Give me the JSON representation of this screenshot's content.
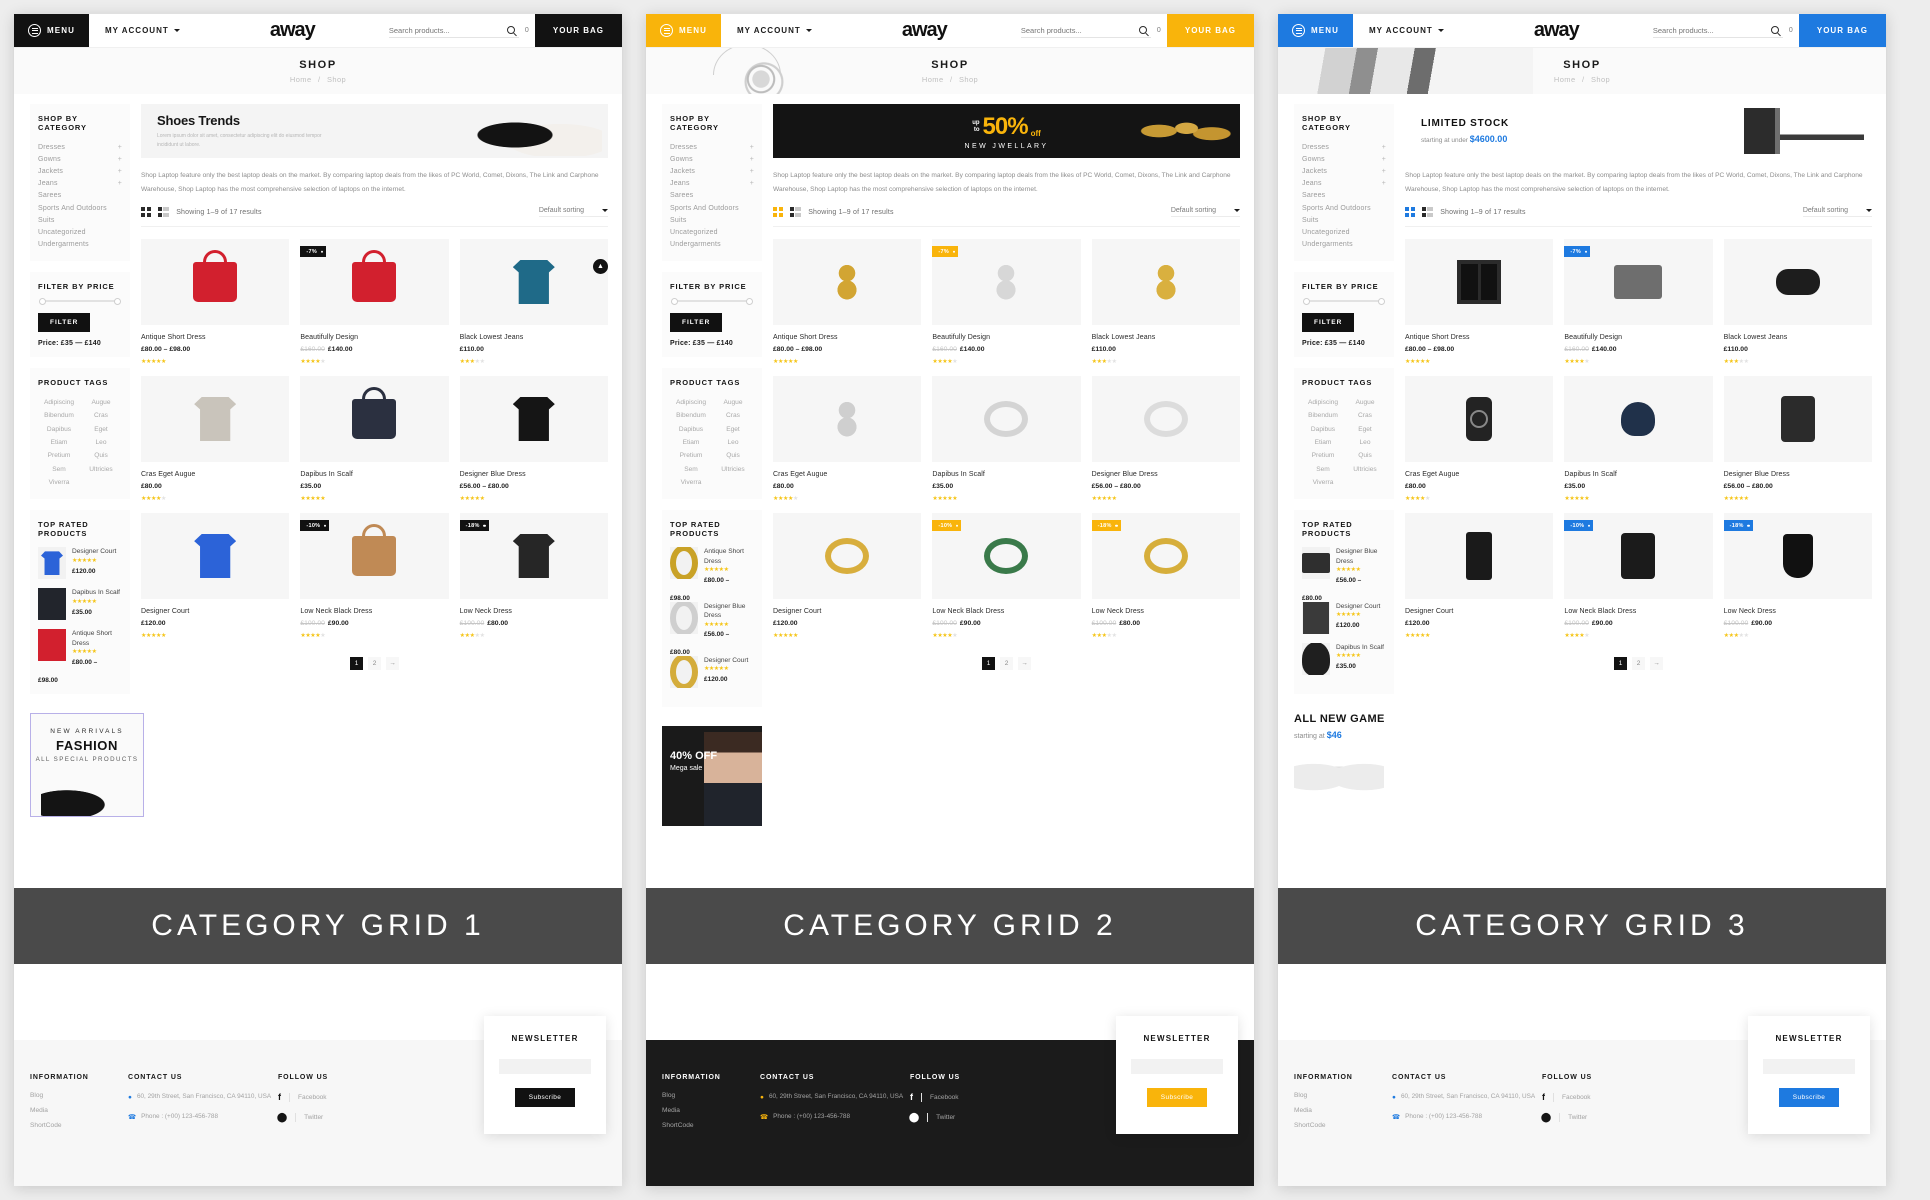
{
  "panels": [
    {
      "id": "grid1",
      "accent": "#121212",
      "caption": "CATEGORY GRID 1",
      "header": {
        "menu_label": "MENU",
        "account_label": "MY ACCOUNT",
        "logo": "away",
        "search_placeholder": "Search products...",
        "bag_count": "0",
        "bag_label": "YOUR BAG"
      },
      "page": {
        "title": "SHOP",
        "crumb_home": "Home",
        "crumb_sep": "/",
        "crumb_current": "Shop"
      },
      "promo": {
        "kind": "shoes",
        "title": "Shoes Trends",
        "subtitle": "Lorem ipsum dolor sit amet, consectetur adipiscing elit do eiusmod tempor incididunt ut labore."
      },
      "intro": "Shop Laptop feature only the best laptop deals on the market. By comparing laptop deals from the likes of PC World, Comet, Dixons, The Link and Carphone Warehouse, Shop Laptop has the most comprehensive selection of laptops on the internet.",
      "toolbar": {
        "showing": "Showing 1–9 of 17 results",
        "sort": "Default sorting"
      },
      "sidebar": {
        "category_title": "SHOP BY CATEGORY",
        "categories": [
          {
            "label": "Dresses",
            "expandable": true
          },
          {
            "label": "Gowns",
            "expandable": true
          },
          {
            "label": "Jackets",
            "expandable": true
          },
          {
            "label": "Jeans",
            "expandable": true
          },
          {
            "label": "Sarees",
            "expandable": false
          },
          {
            "label": "Sports And Outdoors",
            "expandable": false
          },
          {
            "label": "Suits",
            "expandable": false
          },
          {
            "label": "Uncategorized",
            "expandable": false
          },
          {
            "label": "Undergarments",
            "expandable": false
          }
        ],
        "filter_title": "FILTER BY PRICE",
        "filter_button": "FILTER",
        "price_range": "Price: £35 — £140",
        "tags_title": "PRODUCT TAGS",
        "tags": [
          "Adipiscing",
          "Augue",
          "Bibendum",
          "Cras",
          "Dapibus",
          "Eget",
          "Etiam",
          "Leo",
          "Pretium",
          "Quis",
          "Sem",
          "Ultricies",
          "Viverra"
        ],
        "top_rated_title": "TOP RATED PRODUCTS",
        "top_rated": [
          {
            "name": "Designer Court",
            "stars": 5,
            "price": "£120.00",
            "color": "#2c63d8",
            "shape": "shirt"
          },
          {
            "name": "Dapibus In Scalf",
            "stars": 5,
            "price": "£35.00",
            "color": "#22252c",
            "shape": "bag"
          },
          {
            "name": "Antique Short Dress",
            "stars": 5,
            "price_left": "£98.00",
            "price": "£80.00 –",
            "color": "#d2202e",
            "shape": "bag"
          }
        ]
      },
      "products": [
        {
          "name": "Antique Short Dress",
          "price": "£80.00 – £98.00",
          "old": "",
          "stars": 5,
          "badge": "",
          "color": "#d2202e",
          "shape": "bag"
        },
        {
          "name": "Beautifully Design",
          "price": "£140.00",
          "old": "£160.00",
          "stars": 4,
          "badge": "-7%",
          "color": "#d2202e",
          "shape": "bag"
        },
        {
          "name": "Black Lowest Jeans",
          "price": "£110.00",
          "old": "",
          "stars": 3,
          "badge": "",
          "color": "#1f6a88",
          "shape": "polo"
        },
        {
          "name": "Cras Eget Augue",
          "price": "£80.00",
          "old": "",
          "stars": 4,
          "badge": "",
          "color": "#c9c4bb",
          "shape": "sweater"
        },
        {
          "name": "Dapibus In Scalf",
          "price": "£35.00",
          "old": "",
          "stars": 5,
          "badge": "",
          "color": "#2b3040",
          "shape": "bag"
        },
        {
          "name": "Designer Blue Dress",
          "price": "£56.00 – £80.00",
          "old": "",
          "stars": 5,
          "badge": "",
          "color": "#151515",
          "shape": "tshirt"
        },
        {
          "name": "Designer Court",
          "price": "£120.00",
          "old": "",
          "stars": 5,
          "badge": "",
          "color": "#2c63d8",
          "shape": "polo"
        },
        {
          "name": "Low Neck Black Dress",
          "price": "£90.00",
          "old": "£100.00",
          "stars": 4,
          "badge": "-10%",
          "color": "#c08a55",
          "shape": "bag"
        },
        {
          "name": "Low Neck Dress",
          "price": "£80.00",
          "old": "£100.00",
          "stars": 3,
          "badge": "-18%",
          "color": "#262626",
          "shape": "tshirt"
        }
      ],
      "pager": {
        "pages": [
          "1",
          "2"
        ],
        "next": "→",
        "active": "1"
      },
      "lower_promo": {
        "kind": "fashion",
        "line1": "NEW ARRIVALS",
        "line2": "FASHION",
        "line3": "ALL SPECIAL PRODUCTS"
      },
      "footer": {
        "theme": "light",
        "information_title": "INFORMATION",
        "information_links": [
          "Blog",
          "Media",
          "ShortCode"
        ],
        "contact_title": "CONTACT US",
        "address": "60, 29th Street, San Francisco, CA 94110, USA",
        "phone": "Phone : (+00) 123-456-788",
        "follow_title": "FOLLOW US",
        "socials": [
          "Facebook",
          "Twitter"
        ],
        "newsletter_title": "NEWSLETTER",
        "newsletter_button": "Subscribe"
      }
    },
    {
      "id": "grid2",
      "accent": "#f9b40b",
      "caption": "CATEGORY GRID 2",
      "header": {
        "menu_label": "MENU",
        "account_label": "MY ACCOUNT",
        "logo": "away",
        "search_placeholder": "Search products...",
        "bag_count": "0",
        "bag_label": "YOUR BAG"
      },
      "page": {
        "title": "SHOP",
        "crumb_home": "Home",
        "crumb_sep": "/",
        "crumb_current": "Shop"
      },
      "promo": {
        "kind": "fifty",
        "upto": "up\nto",
        "big": "50%",
        "off": "off",
        "sub": "NEW JWELLARY"
      },
      "intro": "Shop Laptop feature only the best laptop deals on the market. By comparing laptop deals from the likes of PC World, Comet, Dixons, The Link and Carphone Warehouse, Shop Laptop has the most comprehensive selection of laptops on the internet.",
      "toolbar": {
        "showing": "Showing 1–9 of 17 results",
        "sort": "Default sorting"
      },
      "sidebar": {
        "category_title": "SHOP BY CATEGORY",
        "categories": [
          {
            "label": "Dresses",
            "expandable": true
          },
          {
            "label": "Gowns",
            "expandable": true
          },
          {
            "label": "Jackets",
            "expandable": true
          },
          {
            "label": "Jeans",
            "expandable": true
          },
          {
            "label": "Sarees",
            "expandable": false
          },
          {
            "label": "Sports And Outdoors",
            "expandable": false
          },
          {
            "label": "Suits",
            "expandable": false
          },
          {
            "label": "Uncategorized",
            "expandable": false
          },
          {
            "label": "Undergarments",
            "expandable": false
          }
        ],
        "filter_title": "FILTER BY PRICE",
        "filter_button": "FILTER",
        "price_range": "Price: £35 — £140",
        "tags_title": "PRODUCT TAGS",
        "tags": [
          "Adipiscing",
          "Augue",
          "Bibendum",
          "Cras",
          "Dapibus",
          "Eget",
          "Etiam",
          "Leo",
          "Pretium",
          "Quis",
          "Sem",
          "Ultricies",
          "Viverra"
        ],
        "top_rated_title": "TOP RATED PRODUCTS",
        "top_rated": [
          {
            "name": "Antique Short Dress",
            "stars": 5,
            "price": "£80.00 –",
            "price_left": "£98.00",
            "color": "#c9a227",
            "shape": "ring"
          },
          {
            "name": "Designer Blue Dress",
            "stars": 5,
            "price": "£56.00 –",
            "price_left": "£80.00",
            "color": "#cfcfcf",
            "shape": "ring"
          },
          {
            "name": "Designer Court",
            "stars": 5,
            "price": "£120.00",
            "color": "#d4ac3b",
            "shape": "ring"
          }
        ]
      },
      "products": [
        {
          "name": "Antique Short Dress",
          "price": "£80.00 – £98.00",
          "old": "",
          "stars": 5,
          "badge": "",
          "color": "#d2a533",
          "shape": "earring"
        },
        {
          "name": "Beautifully Design",
          "price": "£140.00",
          "old": "£160.00",
          "stars": 4,
          "badge": "-7%",
          "color": "#d7d7d7",
          "shape": "pendant"
        },
        {
          "name": "Black Lowest Jeans",
          "price": "£110.00",
          "old": "",
          "stars": 3,
          "badge": "",
          "color": "#d9b03f",
          "shape": "earring"
        },
        {
          "name": "Cras Eget Augue",
          "price": "£80.00",
          "old": "",
          "stars": 4,
          "badge": "",
          "color": "#cfcfcf",
          "shape": "drop"
        },
        {
          "name": "Dapibus In Scalf",
          "price": "£35.00",
          "old": "",
          "stars": 5,
          "badge": "",
          "color": "#d4d4d4",
          "shape": "ring"
        },
        {
          "name": "Designer Blue Dress",
          "price": "£56.00 – £80.00",
          "old": "",
          "stars": 5,
          "badge": "",
          "color": "#dcdcdc",
          "shape": "ring"
        },
        {
          "name": "Designer Court",
          "price": "£120.00",
          "old": "",
          "stars": 5,
          "badge": "",
          "color": "#d8ae3d",
          "shape": "bangle"
        },
        {
          "name": "Low Neck Black Dress",
          "price": "£90.00",
          "old": "£100.00",
          "stars": 4,
          "badge": "-10%",
          "color": "#3a7a4a",
          "shape": "bangle"
        },
        {
          "name": "Low Neck Dress",
          "price": "£80.00",
          "old": "£100.00",
          "stars": 3,
          "badge": "-18%",
          "color": "#d6ae3b",
          "shape": "bangle"
        }
      ],
      "pager": {
        "pages": [
          "1",
          "2"
        ],
        "next": "→",
        "active": "1"
      },
      "lower_promo": {
        "kind": "model",
        "line1": "40% OFF",
        "line2": "Mega sale"
      },
      "footer": {
        "theme": "dark",
        "information_title": "INFORMATION",
        "information_links": [
          "Blog",
          "Media",
          "ShortCode"
        ],
        "contact_title": "CONTACT US",
        "address": "60, 29th Street, San Francisco, CA 94110, USA",
        "phone": "Phone : (+00) 123-456-788",
        "follow_title": "FOLLOW US",
        "socials": [
          "Facebook",
          "Twitter"
        ],
        "newsletter_title": "NEWSLETTER",
        "newsletter_button": "Subscribe"
      }
    },
    {
      "id": "grid3",
      "accent": "#1e7ae0",
      "caption": "CATEGORY GRID 3",
      "header": {
        "menu_label": "MENU",
        "account_label": "MY ACCOUNT",
        "logo": "away",
        "search_placeholder": "Search products...",
        "bag_count": "0",
        "bag_label": "YOUR BAG"
      },
      "page": {
        "title": "SHOP",
        "crumb_home": "Home",
        "crumb_sep": "/",
        "crumb_current": "Shop"
      },
      "promo": {
        "kind": "limited",
        "title": "LIMITED STOCK",
        "sub_pre": "starting at under",
        "sub_price": "$4600.00"
      },
      "intro": "Shop Laptop feature only the best laptop deals on the market. By comparing laptop deals from the likes of PC World, Comet, Dixons, The Link and Carphone Warehouse, Shop Laptop has the most comprehensive selection of laptops on the internet.",
      "toolbar": {
        "showing": "Showing 1–9 of 17 results",
        "sort": "Default sorting"
      },
      "sidebar": {
        "category_title": "SHOP BY CATEGORY",
        "categories": [
          {
            "label": "Dresses",
            "expandable": true
          },
          {
            "label": "Gowns",
            "expandable": true
          },
          {
            "label": "Jackets",
            "expandable": true
          },
          {
            "label": "Jeans",
            "expandable": true
          },
          {
            "label": "Sarees",
            "expandable": false
          },
          {
            "label": "Sports And Outdoors",
            "expandable": false
          },
          {
            "label": "Suits",
            "expandable": false
          },
          {
            "label": "Uncategorized",
            "expandable": false
          },
          {
            "label": "Undergarments",
            "expandable": false
          }
        ],
        "filter_title": "FILTER BY PRICE",
        "filter_button": "FILTER",
        "price_range": "Price: £35 — £140",
        "tags_title": "PRODUCT TAGS",
        "tags": [
          "Adipiscing",
          "Augue",
          "Bibendum",
          "Cras",
          "Dapibus",
          "Eget",
          "Etiam",
          "Leo",
          "Pretium",
          "Quis",
          "Sem",
          "Ultricies",
          "Viverra"
        ],
        "top_rated_title": "TOP RATED PRODUCTS",
        "top_rated": [
          {
            "name": "Designer Blue Dress",
            "stars": 5,
            "price": "£56.00 –",
            "price_left": "£80.00",
            "color": "#2f2f2f",
            "shape": "laptop"
          },
          {
            "name": "Designer Court",
            "stars": 5,
            "price": "£120.00",
            "color": "#3a3a3a",
            "shape": "tower"
          },
          {
            "name": "Dapibus In Scalf",
            "stars": 5,
            "price": "£35.00",
            "color": "#1f1f1f",
            "shape": "cam"
          }
        ]
      },
      "products": [
        {
          "name": "Antique Short Dress",
          "price": "£80.00 – £98.00",
          "old": "",
          "stars": 5,
          "badge": "",
          "color": "#2b2b2b",
          "shape": "speaker"
        },
        {
          "name": "Beautifully Design",
          "price": "£140.00",
          "old": "£160.00",
          "stars": 4,
          "badge": "-7%",
          "color": "#6e6e6e",
          "shape": "printer"
        },
        {
          "name": "Black Lowest Jeans",
          "price": "£110.00",
          "old": "",
          "stars": 3,
          "badge": "",
          "color": "#1d1d1d",
          "shape": "pad"
        },
        {
          "name": "Cras Eget Augue",
          "price": "£80.00",
          "old": "",
          "stars": 4,
          "badge": "",
          "color": "#232323",
          "shape": "watch"
        },
        {
          "name": "Dapibus In Scalf",
          "price": "£35.00",
          "old": "",
          "stars": 5,
          "badge": "",
          "color": "#20314a",
          "shape": "cam"
        },
        {
          "name": "Designer Blue Dress",
          "price": "£56.00 – £80.00",
          "old": "",
          "stars": 5,
          "badge": "",
          "color": "#2b2b2b",
          "shape": "tablet"
        },
        {
          "name": "Designer Court",
          "price": "£120.00",
          "old": "",
          "stars": 5,
          "badge": "",
          "color": "#1a1a1a",
          "shape": "tower"
        },
        {
          "name": "Low Neck Black Dress",
          "price": "£90.00",
          "old": "£100.00",
          "stars": 4,
          "badge": "-10%",
          "color": "#1b1b1b",
          "shape": "tablet"
        },
        {
          "name": "Low Neck Dress",
          "price": "£90.00",
          "old": "£100.00",
          "stars": 3,
          "badge": "-18%",
          "color": "#111111",
          "shape": "lens"
        }
      ],
      "pager": {
        "pages": [
          "1",
          "2"
        ],
        "next": "→",
        "active": "1"
      },
      "lower_promo": {
        "kind": "game",
        "line1": "ALL NEW GAME",
        "line2_pre": "starting at",
        "line2_price": "$46"
      },
      "footer": {
        "theme": "light",
        "information_title": "INFORMATION",
        "information_links": [
          "Blog",
          "Media",
          "ShortCode"
        ],
        "contact_title": "CONTACT US",
        "address": "60, 29th Street, San Francisco, CA 94110, USA",
        "phone": "Phone : (+00) 123-456-788",
        "follow_title": "FOLLOW US",
        "socials": [
          "Facebook",
          "Twitter"
        ],
        "newsletter_title": "NEWSLETTER",
        "newsletter_button": "Subscribe"
      }
    }
  ]
}
